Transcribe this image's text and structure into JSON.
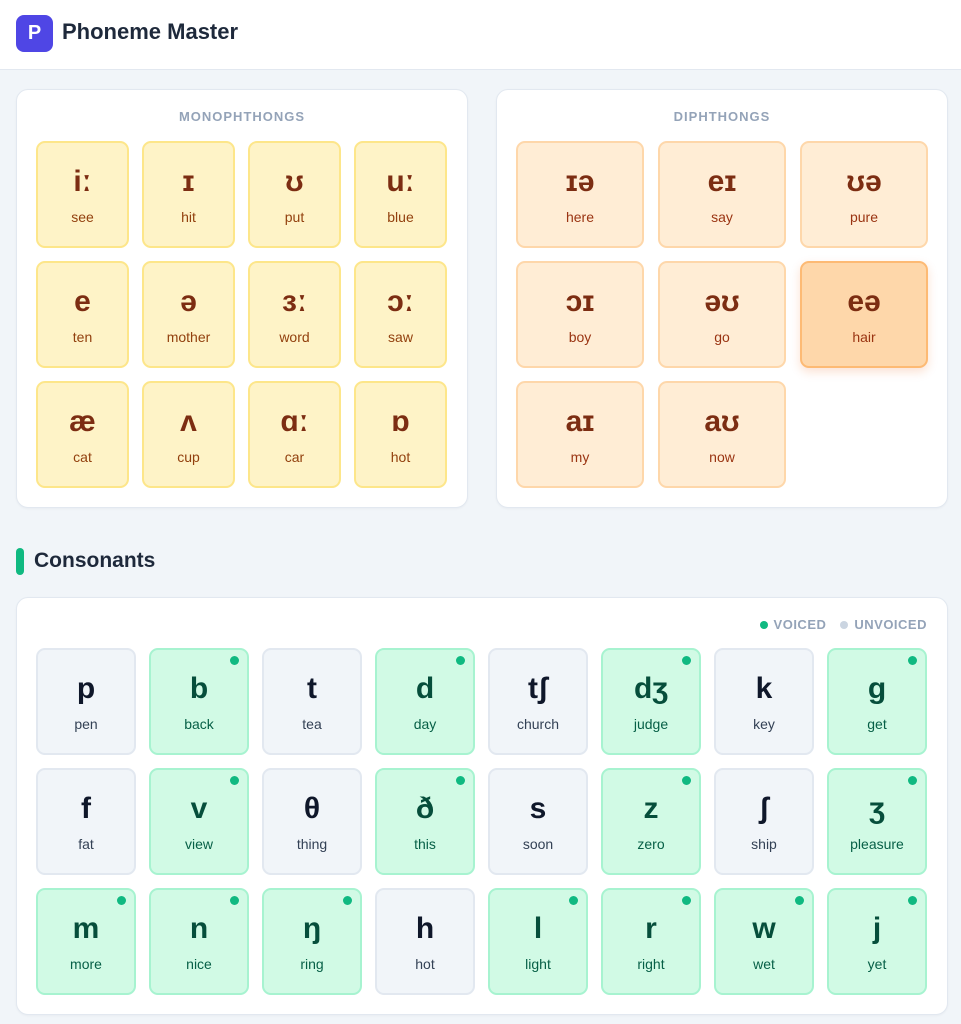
{
  "app": {
    "logo_letter": "P",
    "title": "Phoneme Master"
  },
  "colors": {
    "brand": "#4f46e5",
    "voiced": "#10b981",
    "unvoiced": "#cbd5e1",
    "monophthong_bg": "#fef3c7",
    "diphthong_bg": "#ffedd5",
    "consonant_bg": "#f1f5f9",
    "voiced_bg": "#d1fae5"
  },
  "monophthongs": {
    "title": "MONOPHTHONGS",
    "items": [
      {
        "symbol": "iː",
        "word": "see"
      },
      {
        "symbol": "ɪ",
        "word": "hit"
      },
      {
        "symbol": "ʊ",
        "word": "put"
      },
      {
        "symbol": "uː",
        "word": "blue"
      },
      {
        "symbol": "e",
        "word": "ten"
      },
      {
        "symbol": "ə",
        "word": "mother"
      },
      {
        "symbol": "ɜː",
        "word": "word"
      },
      {
        "symbol": "ɔː",
        "word": "saw"
      },
      {
        "symbol": "æ",
        "word": "cat"
      },
      {
        "symbol": "ʌ",
        "word": "cup"
      },
      {
        "symbol": "ɑː",
        "word": "car"
      },
      {
        "symbol": "ɒ",
        "word": "hot"
      }
    ]
  },
  "diphthongs": {
    "title": "DIPHTHONGS",
    "items": [
      {
        "symbol": "ɪə",
        "word": "here",
        "active": false
      },
      {
        "symbol": "eɪ",
        "word": "say",
        "active": false
      },
      {
        "symbol": "ʊə",
        "word": "pure",
        "active": false
      },
      {
        "symbol": "ɔɪ",
        "word": "boy",
        "active": false
      },
      {
        "symbol": "əʊ",
        "word": "go",
        "active": false
      },
      {
        "symbol": "eə",
        "word": "hair",
        "active": true
      },
      {
        "symbol": "aɪ",
        "word": "my",
        "active": false
      },
      {
        "symbol": "aʊ",
        "word": "now",
        "active": false
      }
    ]
  },
  "consonants": {
    "title": "Consonants",
    "legend": {
      "voiced": "VOICED",
      "unvoiced": "UNVOICED"
    },
    "items": [
      {
        "symbol": "p",
        "word": "pen",
        "voiced": false
      },
      {
        "symbol": "b",
        "word": "back",
        "voiced": true
      },
      {
        "symbol": "t",
        "word": "tea",
        "voiced": false
      },
      {
        "symbol": "d",
        "word": "day",
        "voiced": true
      },
      {
        "symbol": "tʃ",
        "word": "church",
        "voiced": false
      },
      {
        "symbol": "dʒ",
        "word": "judge",
        "voiced": true
      },
      {
        "symbol": "k",
        "word": "key",
        "voiced": false
      },
      {
        "symbol": "g",
        "word": "get",
        "voiced": true
      },
      {
        "symbol": "f",
        "word": "fat",
        "voiced": false
      },
      {
        "symbol": "v",
        "word": "view",
        "voiced": true
      },
      {
        "symbol": "θ",
        "word": "thing",
        "voiced": false
      },
      {
        "symbol": "ð",
        "word": "this",
        "voiced": true
      },
      {
        "symbol": "s",
        "word": "soon",
        "voiced": false
      },
      {
        "symbol": "z",
        "word": "zero",
        "voiced": true
      },
      {
        "symbol": "ʃ",
        "word": "ship",
        "voiced": false
      },
      {
        "symbol": "ʒ",
        "word": "pleasure",
        "voiced": true
      },
      {
        "symbol": "m",
        "word": "more",
        "voiced": true
      },
      {
        "symbol": "n",
        "word": "nice",
        "voiced": true
      },
      {
        "symbol": "ŋ",
        "word": "ring",
        "voiced": true
      },
      {
        "symbol": "h",
        "word": "hot",
        "voiced": false
      },
      {
        "symbol": "l",
        "word": "light",
        "voiced": true
      },
      {
        "symbol": "r",
        "word": "right",
        "voiced": true
      },
      {
        "symbol": "w",
        "word": "wet",
        "voiced": true
      },
      {
        "symbol": "j",
        "word": "yet",
        "voiced": true
      }
    ]
  }
}
